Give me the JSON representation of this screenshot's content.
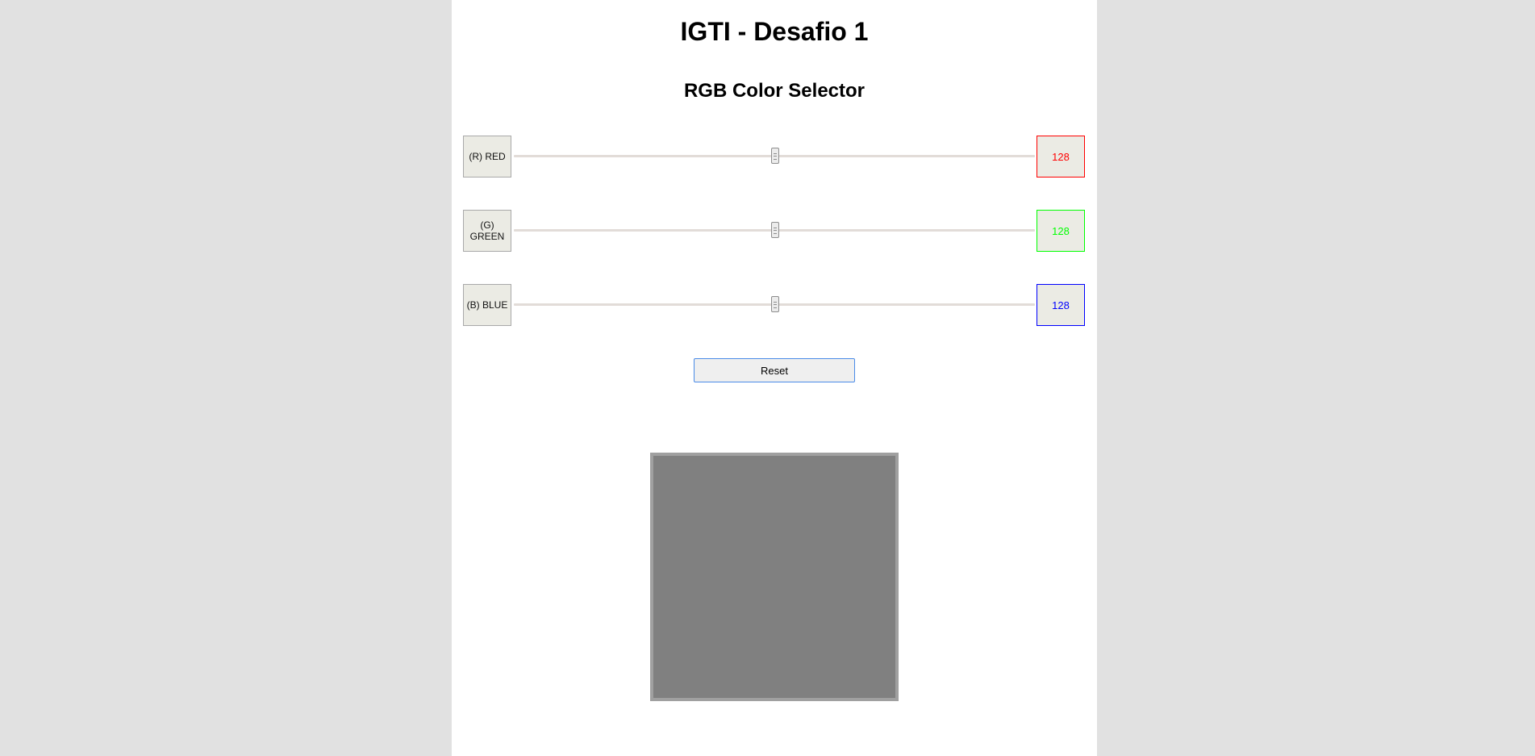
{
  "page": {
    "title": "IGTI - Desafio 1",
    "subtitle": "RGB Color Selector"
  },
  "sliders": [
    {
      "label": "(R) RED",
      "value": "128",
      "fraction": 0.5019,
      "color": "#ff0000"
    },
    {
      "label": "(G) GREEN",
      "value": "128",
      "fraction": 0.5019,
      "color": "#00ff00"
    },
    {
      "label": "(B) BLUE",
      "value": "128",
      "fraction": 0.5019,
      "color": "#0000ff"
    }
  ],
  "reset": {
    "label": "Reset"
  },
  "preview": {
    "color": "#808080"
  }
}
